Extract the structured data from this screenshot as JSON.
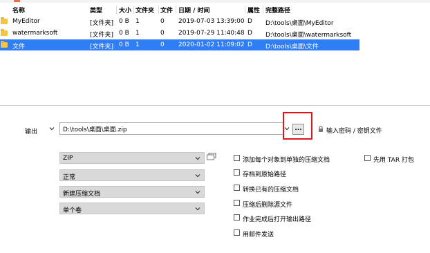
{
  "columns": {
    "name": "名称",
    "type": "类型",
    "size": "大小",
    "folders": "文件夹",
    "files": "文件",
    "date": "日期 / 时间",
    "attr": "属性",
    "path": "完整路径"
  },
  "rows": [
    {
      "name": "MyEditor",
      "type": "[文件夹]",
      "size": "0 B",
      "folders": "1",
      "files": "0",
      "date": "2019-07-03 13:39:00",
      "attr": "D",
      "path": "D:\\tools\\桌面\\MyEditor"
    },
    {
      "name": "watermarksoft",
      "type": "[文件夹]",
      "size": "0 B",
      "folders": "1",
      "files": "0",
      "date": "2019-07-29 11:40:48",
      "attr": "D",
      "path": "D:\\tools\\桌面\\watermarksoft"
    },
    {
      "name": "文件",
      "type": "[文件夹]",
      "size": "0 B",
      "folders": "1",
      "files": "0",
      "date": "2020-01-02 11:09:02",
      "attr": "D",
      "path": "D:\\tools\\桌面\\文件",
      "selected": true
    }
  ],
  "output": {
    "label": "输出",
    "path": "D:\\tools\\桌面\\桌面.zip",
    "browse_label": "...",
    "password_label": "输入密码 / 密钥文件"
  },
  "selects": {
    "format": "ZIP",
    "compression": "正常",
    "update_mode": "新建压缩文档",
    "split": "单个卷"
  },
  "options": {
    "add_each": "添加每个对象到单独的压缩文档",
    "store_path": "存档到原始路径",
    "convert": "转换已有的压缩文档",
    "delete_source": "压缩后删除源文件",
    "open_after": "作业完成后打开输出路径",
    "mail": "用邮件发送",
    "tar_first": "先用 TAR 打包"
  },
  "colors": {
    "selection": "#2f7ef6",
    "highlight": "#e0141b",
    "folder": "#f2c448"
  }
}
